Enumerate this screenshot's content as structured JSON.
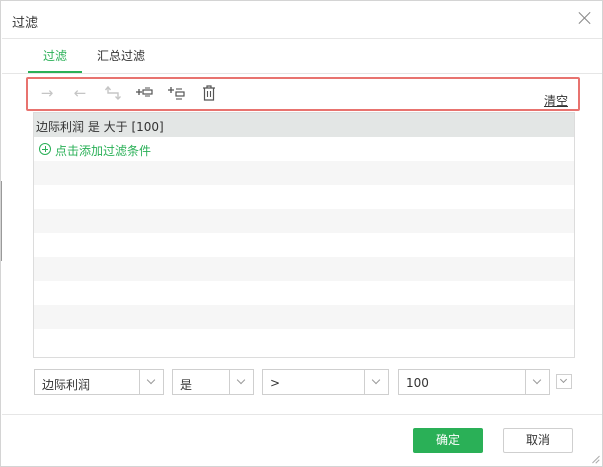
{
  "dialog": {
    "title": "过滤",
    "close_icon": "close-icon"
  },
  "tabs": [
    {
      "label": "过滤",
      "active": true
    },
    {
      "label": "汇总过滤",
      "active": false
    }
  ],
  "toolbar": {
    "buttons": [
      {
        "icon": "arrow-right-icon",
        "glyph": "→",
        "enabled": false
      },
      {
        "icon": "arrow-left-icon",
        "glyph": "←",
        "enabled": false
      },
      {
        "icon": "return-arrow-icon",
        "glyph": "⮤",
        "enabled": false
      },
      {
        "icon": "insert-condition-icon",
        "glyph": "+",
        "enabled": true
      },
      {
        "icon": "add-condition-icon",
        "glyph": "+",
        "enabled": true
      },
      {
        "icon": "trash-icon",
        "glyph": "🗑",
        "enabled": true
      }
    ],
    "clear_label": "清空"
  },
  "conditions": [
    {
      "text": "边际利润 是 大于 [100]"
    }
  ],
  "add_condition_label": "点击添加过滤条件",
  "editor": {
    "field": "边际利润",
    "is": "是",
    "operator": ">",
    "value": "100"
  },
  "footer": {
    "ok_label": "确定",
    "cancel_label": "取消"
  },
  "colors": {
    "accent": "#2ab057",
    "highlight_border": "#e8736f",
    "selected_row": "#e3e6e5"
  }
}
